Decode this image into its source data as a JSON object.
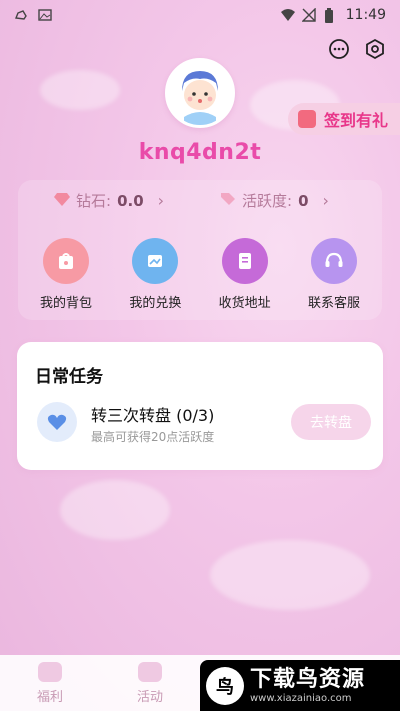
{
  "status_bar": {
    "time": "11:49"
  },
  "profile": {
    "username": "knq4dn2t"
  },
  "signin": {
    "label": "签到有礼"
  },
  "stats": [
    {
      "label": "钻石:",
      "value": "0.0"
    },
    {
      "label": "活跃度:",
      "value": "0"
    }
  ],
  "grid": [
    {
      "label": "我的背包",
      "icon": "backpack-icon",
      "color": "#f79aa4"
    },
    {
      "label": "我的兑换",
      "icon": "exchange-icon",
      "color": "#6fb4ef"
    },
    {
      "label": "收货地址",
      "icon": "address-icon",
      "color": "#c56ad8"
    },
    {
      "label": "联系客服",
      "icon": "service-icon",
      "color": "#b794ef"
    }
  ],
  "daily": {
    "title": "日常任务",
    "task": {
      "title": "转三次转盘 (0/3)",
      "subtitle": "最高可获得20点活跃度",
      "button": "去转盘"
    }
  },
  "nav": [
    {
      "label": "福利"
    },
    {
      "label": "活动"
    }
  ],
  "watermark": {
    "title": "下载鸟资源",
    "url": "www.xiazainiao.com",
    "logo": "鸟"
  }
}
